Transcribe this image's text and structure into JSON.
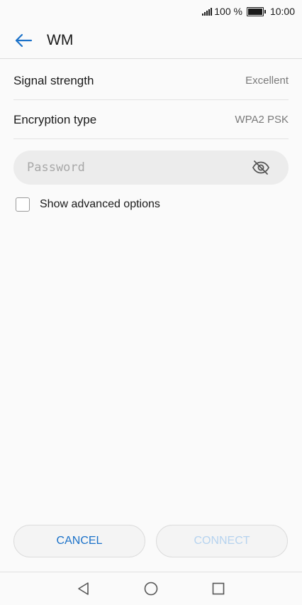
{
  "status_bar": {
    "battery_text": "100 %",
    "time": "10:00"
  },
  "header": {
    "title": "WM",
    "back_icon": "arrow-left-icon"
  },
  "info": {
    "signal_label": "Signal strength",
    "signal_value": "Excellent",
    "encryption_label": "Encryption type",
    "encryption_value": "WPA2 PSK"
  },
  "password": {
    "placeholder": "Password",
    "value": "",
    "toggle_icon": "eye-off-icon"
  },
  "advanced": {
    "label": "Show advanced options",
    "checked": false
  },
  "buttons": {
    "cancel_label": "CANCEL",
    "connect_label": "CONNECT"
  },
  "nav": {
    "back_icon": "nav-back-icon",
    "home_icon": "nav-home-icon",
    "recents_icon": "nav-recents-icon"
  },
  "colors": {
    "accent": "#1c72c9",
    "disabled_accent": "#b6d3ef",
    "background": "#fafafa"
  }
}
